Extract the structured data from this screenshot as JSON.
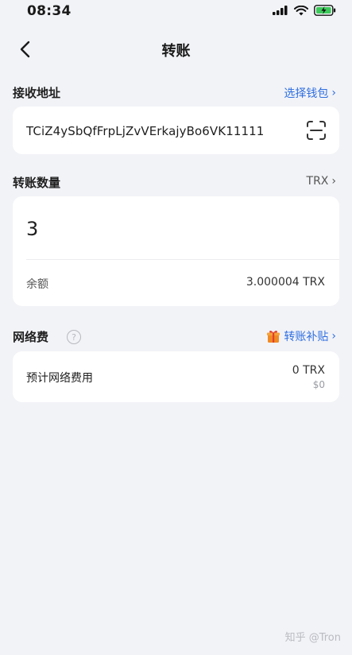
{
  "status_bar": {
    "time": "08:34"
  },
  "nav": {
    "title": "转账"
  },
  "recipient": {
    "label": "接收地址",
    "link_label": "选择钱包",
    "address": "TCiZ4ySbQfFrpLjZvVErkajyBo6VK11111"
  },
  "amount": {
    "label": "转账数量",
    "token": "TRX",
    "value": "3",
    "balance_label": "余额",
    "balance_value": "3.000004 TRX"
  },
  "network_fee": {
    "label": "网络费",
    "help_icon": "?",
    "subsidy_label": "转账补贴",
    "estimate_label": "预计网络费用",
    "estimate_trx": "0 TRX",
    "estimate_usd": "$0"
  },
  "watermark": "知乎 @Tron",
  "colors": {
    "accent": "#2f6fe0",
    "background": "#f2f3f7",
    "card": "#ffffff"
  }
}
